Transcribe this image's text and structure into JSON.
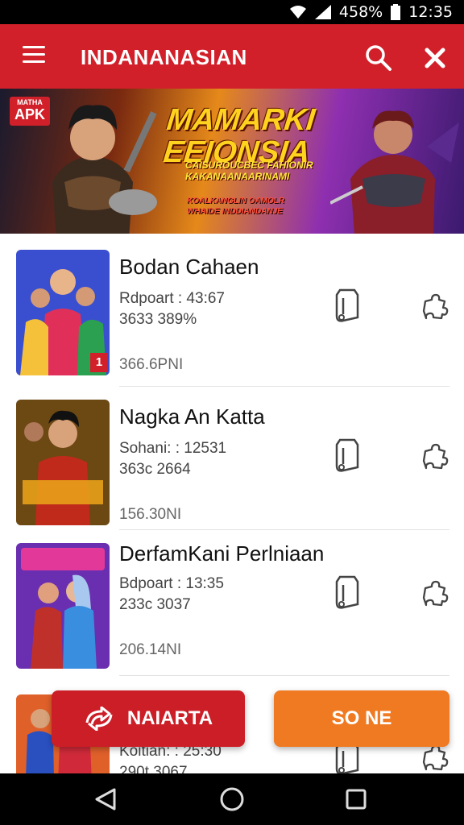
{
  "status_bar": {
    "battery_percent": "458%",
    "time": "12:35"
  },
  "app_bar": {
    "title": "INDANANASIAN"
  },
  "banner": {
    "badge_small": "MATHA",
    "badge_big": "APK",
    "title_line1": "MAMARKI",
    "title_line2": "EEIONSIA",
    "subtitle_lines": [
      "CAISUROUCBEC FAHIONIR",
      "KAKANAANAARINAMI"
    ],
    "subtitle_lines_red": [
      "KOALKANGLIN OAMOLR",
      "WHAIDE INDDIANDANJE"
    ]
  },
  "apps": [
    {
      "name": "Bodan Cahaen",
      "meta1": "Rdpoart  : 43:67",
      "meta2": "3633 389%",
      "size": "366.6PNI",
      "badge": "1",
      "thumb_colors": [
        "#3a4fd0",
        "#e0305a",
        "#f5c13a"
      ]
    },
    {
      "name": "Nagka An Katta",
      "meta1": "Sohani: : 12531",
      "meta2": "363c 2664",
      "size": "156.30NI",
      "badge": "",
      "thumb_colors": [
        "#2a1a10",
        "#e8a11a",
        "#c02a1a"
      ]
    },
    {
      "name": "DerfamKani Perlniaan",
      "meta1": "Bdpoart  : 13:35",
      "meta2": "233c 3037",
      "size": "206.14NI",
      "badge": "",
      "thumb_colors": [
        "#6a2fb0",
        "#e2389a",
        "#3a8ee0"
      ]
    },
    {
      "name": "",
      "meta1": "Koitian: : 25:30",
      "meta2": "290t 3067",
      "size": "",
      "badge": "",
      "thumb_colors": [
        "#e0602a",
        "#2a50c0",
        "#d02a3a"
      ]
    }
  ],
  "buttons": {
    "primary_label": "NAIARTA",
    "secondary_label": "SO NE"
  },
  "colors": {
    "brand_red": "#d1202a",
    "accent_orange": "#f07a22"
  }
}
